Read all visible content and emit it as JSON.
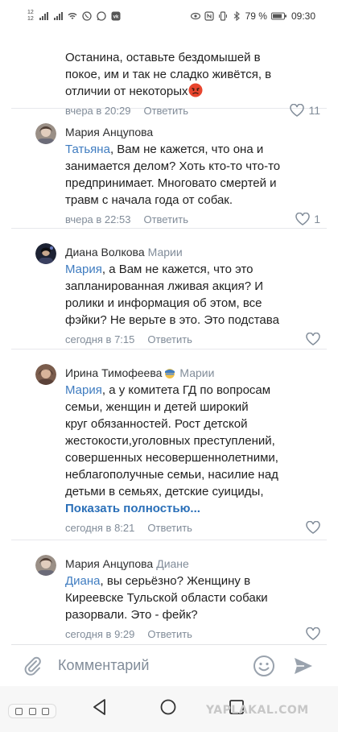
{
  "status_bar": {
    "sim_top": "12",
    "sim_bottom": "12",
    "battery": "79 %",
    "time": "09:30"
  },
  "comments": [
    {
      "author": "",
      "reply_to": "",
      "mention": "",
      "text": "Останина, оставьте бездомышей в\nпокое, им и так не сладко живётся, в\nотличии от некоторых",
      "emoji": "angry-face-emoji",
      "date": "вчера в 20:29",
      "reply_label": "Ответить",
      "likes": "11"
    },
    {
      "author": "Мария Анцупова",
      "reply_to": "",
      "mention": "Татьяна",
      "text": ", Вам не кажется, что она и\nзанимается делом? Хоть кто-то что-то\nпредпринимает. Многовато смертей и\nтравм с начала года от собак.",
      "date": "вчера в 22:53",
      "reply_label": "Ответить",
      "likes": "1"
    },
    {
      "author": "Диана Волкова",
      "reply_to": "Марии",
      "mention": "Мария",
      "text": ", а Вам не кажется, что это\nзапланированная лживая акция? И\nролики и информация об этом, все\nфэйки? Не верьте в это. Это подстава",
      "date": "сегодня в 7:15",
      "reply_label": "Ответить",
      "likes": ""
    },
    {
      "author": "Ирина Тимофеева",
      "reply_to": "Марии",
      "mention": "Мария",
      "text": ",  а у  комитета ГД по вопросам\nсемьи, женщин и детей широкий\nкруг обязанностей.  Рост детской\nжестокости,уголовных преступлений,\nсовершенных несовершеннолетними,\nнеблагополучные семьи, насилие над\nдетьми в семьях, детские суициды,",
      "show_more": "Показать полностью...",
      "date": "сегодня в 8:21",
      "reply_label": "Ответить",
      "likes": ""
    },
    {
      "author": "Мария Анцупова",
      "reply_to": "Диане",
      "mention": "Диана",
      "text": ", вы серьёзно? Женщину в\nКиреевске Тульской области собаки\nразорвали. Это - фейк?",
      "date": "сегодня в 9:29",
      "reply_label": "Ответить",
      "likes": ""
    }
  ],
  "composer": {
    "placeholder": "Комментарий"
  },
  "watermark": "YAPLAKAL.COM",
  "colors": {
    "link": "#3f7cc0",
    "muted": "#818c99",
    "text": "#1f1f1f"
  }
}
